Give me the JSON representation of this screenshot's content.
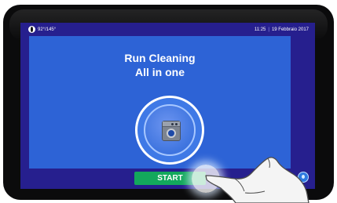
{
  "status_bar": {
    "left_text": "92°/145°",
    "time": "11:25",
    "date": "19 Febbraio 2017",
    "icon": "globe-icon"
  },
  "program": {
    "title_line1": "Run Cleaning",
    "title_line2": "All in one",
    "icon": "washer-icon"
  },
  "actions": {
    "start_label": "START",
    "info_icon": "info-icon"
  },
  "colors": {
    "screen_background": "#261f8e",
    "main_panel": "#2d63d6",
    "start_button": "#13a85c",
    "bezel": "#0b0b0c"
  }
}
